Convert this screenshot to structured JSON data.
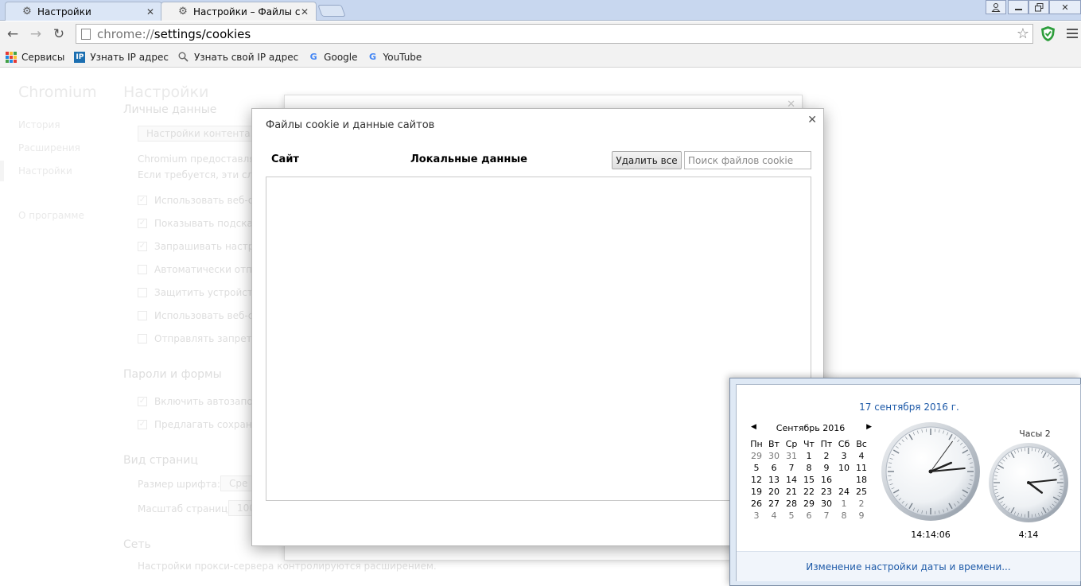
{
  "tabs": [
    {
      "title": "Настройки"
    },
    {
      "title": "Настройки – Файлы cookie"
    }
  ],
  "omnibox": {
    "url_scheme": "chrome://",
    "url_path": "settings/cookies"
  },
  "bookmarks": [
    {
      "label": "Сервисы",
      "icon": "apps-grid-icon"
    },
    {
      "label": "Узнать IP адрес",
      "icon": "ip-icon"
    },
    {
      "label": "Узнать свой IP адрес",
      "icon": "search-icon"
    },
    {
      "label": "Google",
      "icon": "google-icon"
    },
    {
      "label": "YouTube",
      "icon": "google-icon"
    }
  ],
  "settings_bg": {
    "brand": "Chromium",
    "title": "Настройки",
    "sidebar": [
      "История",
      "Расширения",
      "Настройки",
      "О программе"
    ],
    "section_personal": "Личные данные",
    "content_settings_btn": "Настройки контента...",
    "text1": "Chromium предоставляет",
    "text2": "Если требуется, эти служ",
    "checks": [
      "Использовать веб-сл",
      "Показывать подсказ",
      "Запрашивать настро",
      "Автоматически отпра",
      "Защитить устройств",
      "Использовать веб-сл",
      "Отправлять запрет от"
    ],
    "section_passwords": "Пароли и формы",
    "checks2": [
      "Включить автозапол",
      "Предлагать сохранят"
    ],
    "section_view": "Вид страниц",
    "font_size": "Размер шрифта:",
    "font_size_val": "Сре",
    "zoom": "Масштаб страницы:",
    "zoom_val": "100",
    "section_network": "Сеть",
    "proxy_text": "Настройки прокси-сервера контролируются расширением."
  },
  "cookie_dialog": {
    "title": "Файлы cookie и данные сайтов",
    "col_site": "Сайт",
    "col_local": "Локальные данные",
    "delete_all": "Удалить все",
    "search_placeholder": "Поиск файлов cookie"
  },
  "clock_popup": {
    "full_date": "17 сентября 2016 г.",
    "month": "Сентябрь 2016",
    "weekdays": [
      "Пн",
      "Вт",
      "Ср",
      "Чт",
      "Пт",
      "Сб",
      "Вс"
    ],
    "days": [
      [
        "29",
        "30",
        "31",
        "1",
        "2",
        "3",
        "4"
      ],
      [
        "5",
        "6",
        "7",
        "8",
        "9",
        "10",
        "11"
      ],
      [
        "12",
        "13",
        "14",
        "15",
        "16",
        "17",
        "18"
      ],
      [
        "19",
        "20",
        "21",
        "22",
        "23",
        "24",
        "25"
      ],
      [
        "26",
        "27",
        "28",
        "29",
        "30",
        "1",
        "2"
      ],
      [
        "3",
        "4",
        "5",
        "6",
        "7",
        "8",
        "9"
      ]
    ],
    "today": "17",
    "clock1_time": "14:14:06",
    "clock2_title": "Часы 2",
    "clock2_time": "4:14",
    "settings_link": "Изменение настройки даты и времени..."
  },
  "colors": {
    "link": "#1e5aa8",
    "tabstrip": "#c8d7ef",
    "shield": "#2e9e3c"
  }
}
